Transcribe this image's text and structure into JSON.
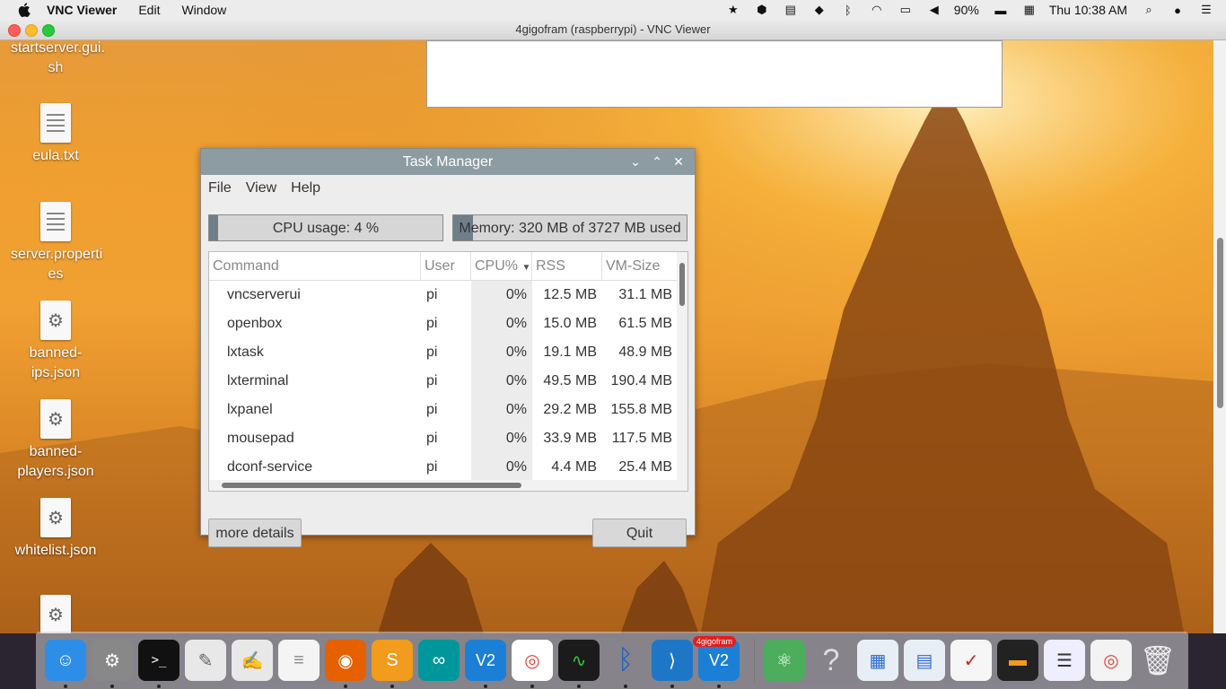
{
  "menubar": {
    "app_name": "VNC Viewer",
    "items": [
      "Edit",
      "Window"
    ],
    "battery": "90%",
    "clock": "Thu 10:38 AM"
  },
  "vnc": {
    "title": "4gigofram (raspberrypi) - VNC Viewer"
  },
  "desktop_icons": [
    {
      "label": "startserver.gui.\nsh",
      "type": "file"
    },
    {
      "label": "eula.txt",
      "type": "text"
    },
    {
      "label": "server.properti\nes",
      "type": "text"
    },
    {
      "label": "banned-\nips.json",
      "type": "gear"
    },
    {
      "label": "banned-\nplayers.json",
      "type": "gear"
    },
    {
      "label": "whitelist.json",
      "type": "gear"
    }
  ],
  "task_manager": {
    "title": "Task Manager",
    "menu": [
      "File",
      "View",
      "Help"
    ],
    "cpu_label": "CPU usage: 4 %",
    "cpu_fraction": 0.04,
    "memory_label": "Memory: 320 MB of 3727 MB used",
    "memory_fraction": 0.086,
    "columns": [
      "Command",
      "User",
      "CPU%",
      "RSS",
      "VM-Size"
    ],
    "rows": [
      [
        "vncserverui",
        "pi",
        "0%",
        "12.5 MB",
        "31.1 MB"
      ],
      [
        "openbox",
        "pi",
        "0%",
        "15.0 MB",
        "61.5 MB"
      ],
      [
        "lxtask",
        "pi",
        "0%",
        "19.1 MB",
        "48.9 MB"
      ],
      [
        "lxterminal",
        "pi",
        "0%",
        "49.5 MB",
        "190.4 MB"
      ],
      [
        "lxpanel",
        "pi",
        "0%",
        "29.2 MB",
        "155.8 MB"
      ],
      [
        "mousepad",
        "pi",
        "0%",
        "33.9 MB",
        "117.5 MB"
      ],
      [
        "dconf-service",
        "pi",
        "0%",
        "4.4 MB",
        "25.4 MB"
      ]
    ],
    "more_details": "more details",
    "quit": "Quit"
  },
  "dock": {
    "badge": "4gigofram"
  }
}
